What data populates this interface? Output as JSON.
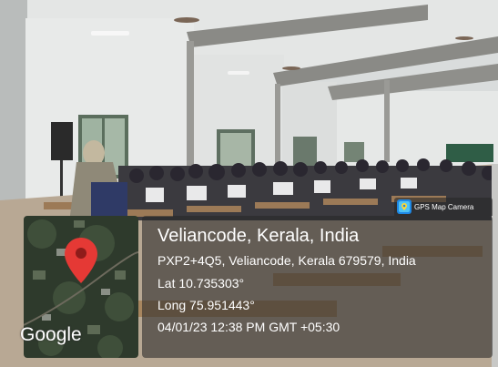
{
  "badge": {
    "label": "GPS Map Camera",
    "icon": "gps-map-camera-icon"
  },
  "location": {
    "title": "Veliancode, Kerala, India",
    "address": "PXP2+4Q5, Veliancode, Kerala 679579, India",
    "lat": "Lat 10.735303°",
    "long": "Long 75.951443°",
    "datetime": "04/01/23 12:38 PM GMT +05:30"
  },
  "map": {
    "brand": "Google",
    "pin_color": "#e53935"
  },
  "colors": {
    "overlay": "#282828",
    "text": "#ffffff"
  }
}
